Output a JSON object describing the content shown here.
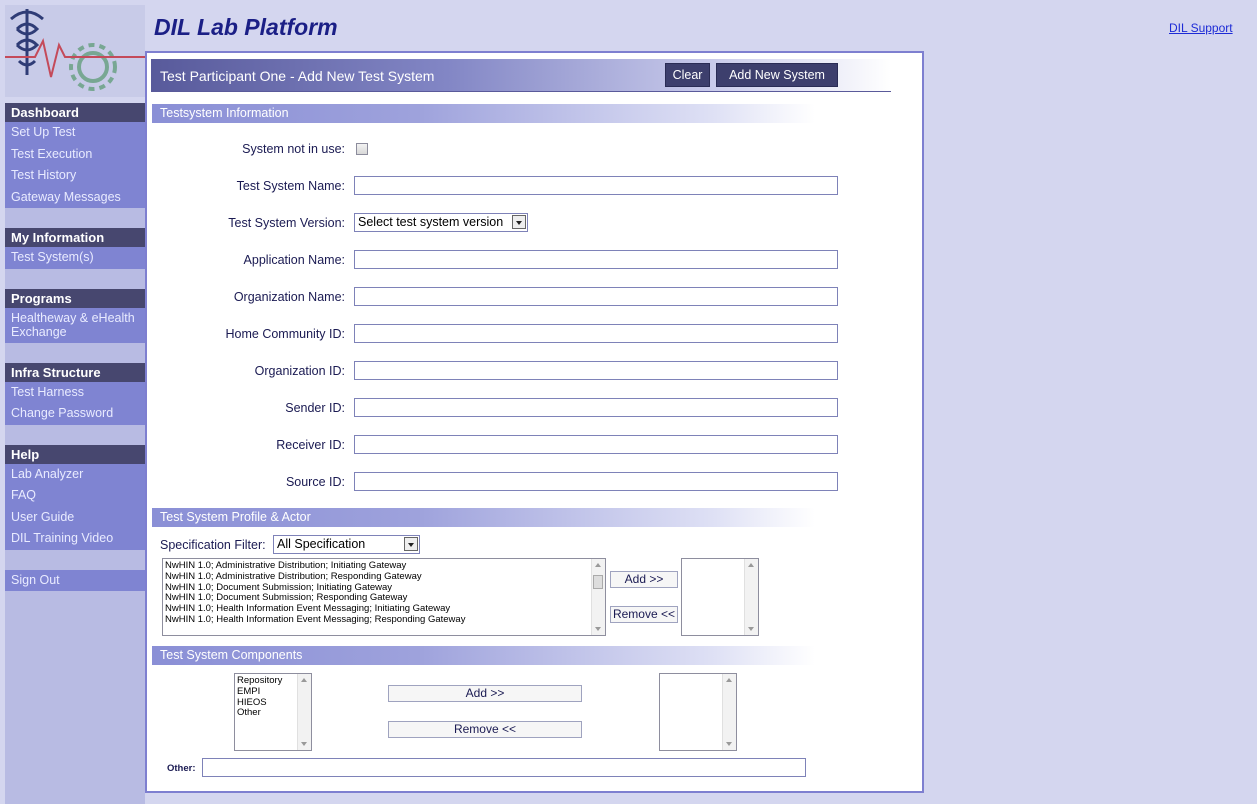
{
  "header": {
    "title": "DIL Lab Platform",
    "support_link": "DIL Support"
  },
  "sidebar": {
    "sections": [
      {
        "heading": "Dashboard",
        "items": [
          "Set Up Test",
          "Test Execution",
          "Test History",
          "Gateway Messages"
        ]
      },
      {
        "heading": "My Information",
        "items": [
          "Test System(s)"
        ]
      },
      {
        "heading": "Programs",
        "items": [
          "Healtheway & eHealth Exchange"
        ]
      },
      {
        "heading": "Infra Structure",
        "items": [
          "Test Harness",
          "Change Password"
        ]
      },
      {
        "heading": "Help",
        "items": [
          "Lab Analyzer",
          "FAQ",
          "User Guide",
          "DIL Training Video"
        ]
      },
      {
        "heading": "",
        "items": [
          "Sign Out"
        ]
      }
    ]
  },
  "panel": {
    "title": "Test Participant One - Add New Test System",
    "clear_button": "Clear",
    "add_system_button": "Add New System",
    "info_section": "Testsystem Information",
    "fields": {
      "not_in_use": "System not in use:",
      "system_name": "Test System Name:",
      "system_version": "Test System Version:",
      "version_selected": "Select test system version",
      "application_name": "Application Name:",
      "organization_name": "Organization Name:",
      "home_community_id": "Home Community ID:",
      "organization_id": "Organization ID:",
      "sender_id": "Sender ID:",
      "receiver_id": "Receiver ID:",
      "source_id": "Source ID:"
    },
    "profile_section": "Test System Profile & Actor",
    "spec_filter_label": "Specification Filter:",
    "spec_filter_value": "All Specification",
    "profile_options": [
      "NwHIN 1.0; Administrative Distribution; Initiating Gateway",
      "NwHIN 1.0; Administrative Distribution; Responding Gateway",
      "NwHIN 1.0; Document Submission; Initiating Gateway",
      "NwHIN 1.0; Document Submission; Responding Gateway",
      "NwHIN 1.0; Health Information Event Messaging; Initiating Gateway",
      "NwHIN 1.0; Health Information Event Messaging; Responding Gateway"
    ],
    "profile_add": "Add >>",
    "profile_remove": "Remove <<",
    "components_section": "Test System Components",
    "component_options": [
      "Repository",
      "EMPI",
      "HIEOS",
      "Other"
    ],
    "component_add": "Add >>",
    "component_remove": "Remove <<",
    "other_label": "Other:"
  },
  "colors": {
    "brand_title": "#1b1f86",
    "sidebar_heading": "#47476f",
    "sidebar_group": "#7f84d2",
    "link": "#1d2bd6"
  }
}
